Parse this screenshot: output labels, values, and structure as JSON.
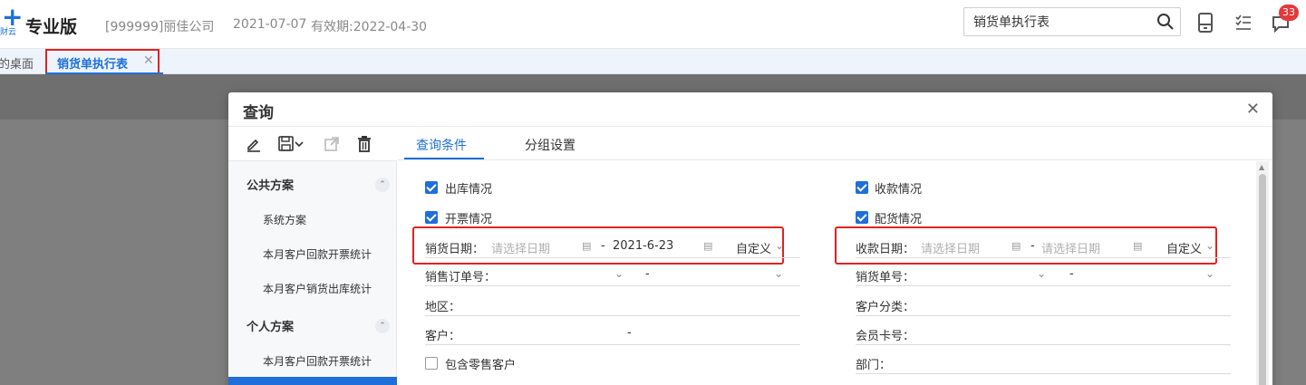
{
  "header": {
    "logo_sub": "财云",
    "brand": "专业版",
    "company": "[999999]丽佳公司",
    "date": "2021-07-07",
    "validity": "有效期:2022-04-30",
    "search_value": "销货单执行表",
    "notification_count": "33"
  },
  "tabs": {
    "desktop": "的桌面",
    "active": "销货单执行表",
    "close": "✕"
  },
  "dialog": {
    "title": "查询",
    "close": "✕",
    "left": {
      "public_section": "公共方案",
      "public_items": [
        "系统方案",
        "本月客户回款开票统计",
        "本月客户销货出库统计"
      ],
      "personal_section": "个人方案",
      "personal_items": [
        "本月客户回款开票统计"
      ]
    },
    "right_tabs": [
      "查询条件",
      "分组设置"
    ],
    "checkboxes": [
      {
        "label": "出库情况",
        "checked": true
      },
      {
        "label": "开票情况",
        "checked": true
      },
      {
        "label": "收款情况",
        "checked": true
      },
      {
        "label": "配货情况",
        "checked": true
      },
      {
        "label": "包含零售客户",
        "checked": false
      }
    ],
    "fields": {
      "sales_date_label": "销货日期：",
      "sales_date_from_placeholder": "请选择日期",
      "sales_date_to": "2021-6-23",
      "sales_date_range": "自定义",
      "receipt_date_label": "收款日期：",
      "receipt_date_from_placeholder": "请选择日期",
      "receipt_date_to_placeholder": "请选择日期",
      "receipt_date_range": "自定义",
      "dash": "-",
      "sales_order_label": "销售订单号：",
      "sales_order_sep": "-",
      "sales_no_label": "销货单号：",
      "sales_no_sep": "-",
      "region_label": "地区：",
      "customer_category_label": "客户分类：",
      "customer_label": "客户：",
      "customer_sep": "-",
      "member_card_label": "会员卡号：",
      "department_label": "部门："
    }
  },
  "colors": {
    "accent": "#1e6fd9",
    "highlight": "#e02323",
    "badge": "#e4393c"
  }
}
